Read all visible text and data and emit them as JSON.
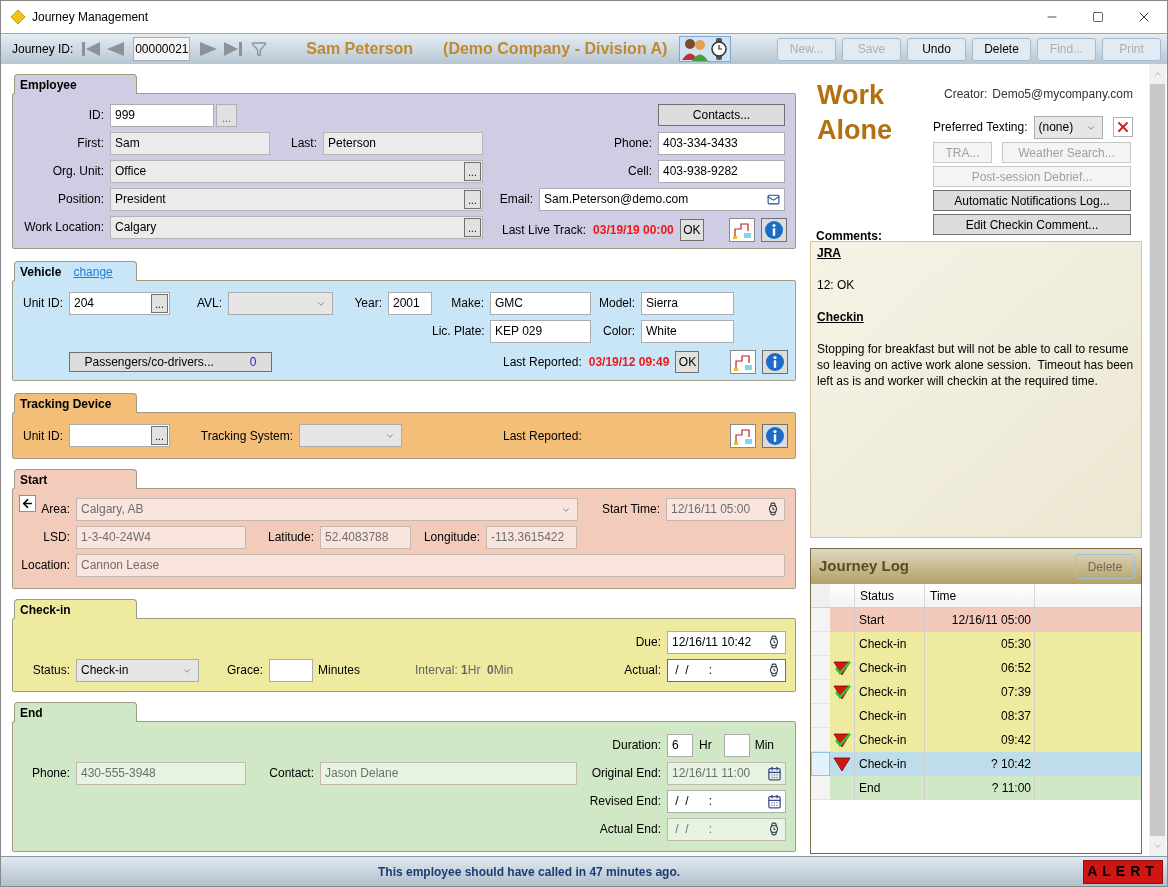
{
  "window": {
    "title": "Journey Management"
  },
  "toolbar": {
    "id_label": "Journey ID:",
    "journey_id": "00000021",
    "employee": "Sam Peterson",
    "company": "(Demo Company - Division A)",
    "buttons": [
      {
        "label": "New...",
        "disabled": true
      },
      {
        "label": "Save",
        "disabled": true
      },
      {
        "label": "Undo",
        "disabled": false
      },
      {
        "label": "Delete",
        "disabled": false
      },
      {
        "label": "Find...",
        "disabled": true
      },
      {
        "label": "Print",
        "disabled": true
      }
    ]
  },
  "employee": {
    "tab": "Employee",
    "contacts_button": "Contacts...",
    "id": {
      "label": "ID:",
      "value": "999",
      "kind": "lookup",
      "button": "..."
    },
    "first": {
      "label": "First:",
      "value": "Sam",
      "readonly": true
    },
    "last": {
      "label": "Last:",
      "value": "Peterson",
      "readonly": true
    },
    "org_unit": {
      "label": "Org. Unit:",
      "value": "Office",
      "kind": "lookup",
      "button": "...",
      "readonly": true
    },
    "position": {
      "label": "Position:",
      "value": "President",
      "kind": "lookup",
      "button": "...",
      "readonly": true
    },
    "work_location": {
      "label": "Work Location:",
      "value": "Calgary",
      "kind": "lookup",
      "button": "...",
      "readonly": true
    },
    "phone": {
      "label": "Phone:",
      "value": "403-334-3433"
    },
    "cell": {
      "label": "Cell:",
      "value": "403-938-9282"
    },
    "email": {
      "label": "Email:",
      "value": "Sam.Peterson@demo.com",
      "kind": "email"
    },
    "last_live_track": {
      "label": "Last Live Track:",
      "value": "03/19/19 00:00"
    },
    "ok_button": "OK"
  },
  "vehicle": {
    "tab": "Vehicle",
    "change_link": "change",
    "unit_id": {
      "label": "Unit ID:",
      "value": "204",
      "kind": "lookup",
      "button": "..."
    },
    "avl": {
      "label": "AVL:",
      "kind": "select"
    },
    "year": {
      "label": "Year:",
      "value": "2001"
    },
    "make": {
      "label": "Make:",
      "value": "GMC"
    },
    "model": {
      "label": "Model:",
      "value": "Sierra"
    },
    "lic_plate": {
      "label": "Lic. Plate:",
      "value": "KEP 029"
    },
    "color": {
      "label": "Color:",
      "value": "White"
    },
    "passengers_button": "Passengers/co-drivers...",
    "passengers_count": "0",
    "last_reported": {
      "label": "Last Reported:",
      "value": "03/19/12 09:49"
    },
    "ok_button": "OK"
  },
  "tracking_device": {
    "tab": "Tracking Device",
    "unit_id": {
      "label": "Unit ID:",
      "kind": "lookup",
      "button": "..."
    },
    "tracking_system": {
      "label": "Tracking System:",
      "kind": "select"
    },
    "last_reported_label": "Last Reported:"
  },
  "start": {
    "tab": "Start",
    "area": {
      "label": "Area:",
      "value": "Calgary, AB",
      "kind": "select",
      "disabled": true
    },
    "start_time": {
      "label": "Start Time:",
      "value": "12/16/11 05:00",
      "kind": "time",
      "disabled": true
    },
    "lsd": {
      "label": "LSD:",
      "value": "1-3-40-24W4",
      "disabled": true
    },
    "latitude": {
      "label": "Latitude:",
      "value": "52.4083788",
      "disabled": true
    },
    "longitude": {
      "label": "Longitude:",
      "value": "-113.3615422",
      "disabled": true
    },
    "location": {
      "label": "Location:",
      "value": "Cannon Lease",
      "disabled": true
    }
  },
  "checkin": {
    "tab": "Check-in",
    "due": {
      "label": "Due:",
      "value": "12/16/11 10:42",
      "kind": "time"
    },
    "status": {
      "label": "Status:",
      "value": "Check-in",
      "kind": "select"
    },
    "grace": {
      "label": "Grace:"
    },
    "grace_unit": "Minutes",
    "interval": "Interval: **1**Hr  **0**Min",
    "actual": {
      "label": "Actual:",
      "value": " /  /      :",
      "kind": "time",
      "focused": true
    }
  },
  "end": {
    "tab": "End",
    "duration": {
      "label": "Duration:",
      "value": "6"
    },
    "duration_hours_unit": "Hr",
    "duration_minutes": {
      "disabled": false
    },
    "duration_minutes_unit": "Min",
    "phone": {
      "label": "Phone:",
      "value": "430-555-3948",
      "disabled": true
    },
    "contact": {
      "label": "Contact:",
      "value": "Jason Delane",
      "disabled": true
    },
    "original_end": {
      "label": "Original End:",
      "value": "12/16/11 11:00",
      "kind": "date",
      "disabled": true
    },
    "revised_end": {
      "label": "Revised End:",
      "value": " /  /      :",
      "kind": "date"
    },
    "actual_end": {
      "label": "Actual End:",
      "value": " /  /      :",
      "kind": "time",
      "disabled": true
    }
  },
  "work_alone": {
    "title": "Work Alone",
    "creator_label": "Creator:",
    "creator": "Demo5@mycompany.com",
    "texting": {
      "label": "Preferred Texting:",
      "value": "(none)",
      "kind": "select"
    },
    "buttons": [
      {
        "label": "TRA...",
        "disabled": true
      },
      {
        "label": "Weather Search...",
        "disabled": true
      },
      {
        "label": "Post-session Debrief...",
        "disabled": true
      },
      {
        "label": "Automatic Notifications Log...",
        "disabled": false
      },
      {
        "label": "Edit Checkin Comment...",
        "disabled": false
      }
    ]
  },
  "comments": {
    "label": "Comments:",
    "blocks": [
      {
        "kind": "heading",
        "text": "JRA"
      },
      {
        "kind": "text",
        "text": "12: OK"
      },
      {
        "kind": "heading",
        "text": "Checkin"
      },
      {
        "kind": "text",
        "text": "Stopping for breakfast but will not be able to call to resume so leaving on active work alone session.  Timeout has been left as is and worker will checkin at the required time."
      }
    ]
  },
  "journey_log": {
    "title": "Journey Log",
    "delete_button": "Delete",
    "delete_disabled": true,
    "columns": [
      "Status",
      "Time"
    ],
    "rows": [
      {
        "status": "Start",
        "time": "12/16/11 05:00",
        "color": "#f2c9bb",
        "selected": false,
        "alarm": false,
        "acknowledged": false
      },
      {
        "status": "Check-in",
        "time": "05:30",
        "color": "#eeeba0",
        "selected": false,
        "alarm": false,
        "acknowledged": false
      },
      {
        "status": "Check-in",
        "time": "06:52",
        "color": "#eeeba0",
        "selected": false,
        "alarm": true,
        "acknowledged": true
      },
      {
        "status": "Check-in",
        "time": "07:39",
        "color": "#eeeba0",
        "selected": false,
        "alarm": true,
        "acknowledged": true
      },
      {
        "status": "Check-in",
        "time": "08:37",
        "color": "#eeeba0",
        "selected": false,
        "alarm": false,
        "acknowledged": false
      },
      {
        "status": "Check-in",
        "time": "09:42",
        "color": "#eeeba0",
        "selected": false,
        "alarm": true,
        "acknowledged": true
      },
      {
        "status": "Check-in",
        "time": "? 10:42",
        "color": "#bcdde9",
        "selected": true,
        "alarm": true,
        "acknowledged": false
      },
      {
        "status": "End",
        "time": "? 11:00",
        "color": "#d0e8c5",
        "selected": false,
        "alarm": false,
        "acknowledged": false
      }
    ]
  },
  "status_bar": {
    "message": "This employee should have called in 47 minutes ago.",
    "alert": "ALERT"
  }
}
